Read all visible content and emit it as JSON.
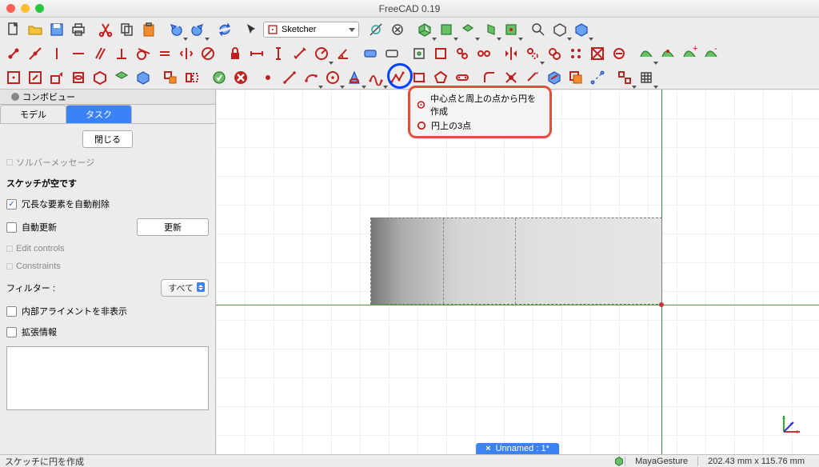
{
  "window": {
    "title": "FreeCAD 0.19"
  },
  "workbench": {
    "selected": "Sketcher"
  },
  "popup": {
    "opt1": "中心点と周上の点から円を作成",
    "opt2": "円上の3点"
  },
  "combo": {
    "header": "コンボビュー",
    "tabs": {
      "model": "モデル",
      "task": "タスク"
    },
    "close_btn": "閉じる",
    "solver_msg": "ソルバーメッセージ",
    "sketch_empty": "スケッチが空です",
    "auto_remove_redundant": "冗長な要素を自動削除",
    "auto_update": "自動更新",
    "update_btn": "更新",
    "edit_controls": "Edit controls",
    "constraints": "Constraints",
    "filter_label": "フィルター :",
    "filter_value": "すべて",
    "hide_internal": "内部アライメントを非表示",
    "ext_info": "拡張情報"
  },
  "doc_tab": "Unnamed : 1*",
  "status": {
    "hint": "スケッチに円を作成",
    "nav_style": "MayaGesture",
    "coords": "202.43 mm x 115.76 mm"
  },
  "chart_data": null
}
